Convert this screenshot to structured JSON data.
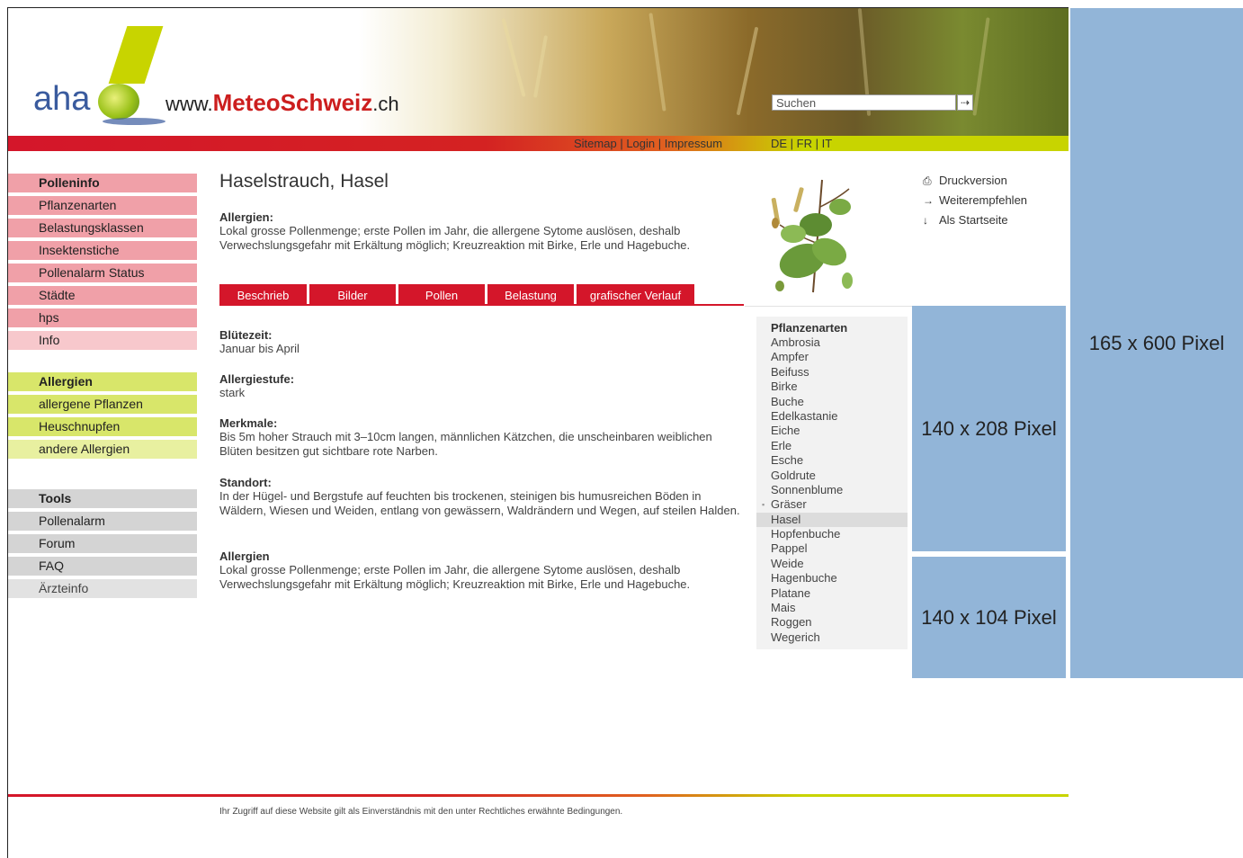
{
  "header": {
    "logo_text": "aha",
    "site_prefix": "www.",
    "site_name": "MeteoSchweiz",
    "site_suffix": ".ch",
    "search_placeholder": "Suchen",
    "search_button": "⇢"
  },
  "band": {
    "links": [
      "Sitemap",
      "Login",
      "Impressum"
    ],
    "separator": " | ",
    "languages": [
      "DE",
      "FR",
      "IT"
    ]
  },
  "nav": {
    "pollen": [
      "Polleninfo",
      "Pflanzenarten",
      "Belastungsklassen",
      "Insektenstiche",
      "Pollenalarm Status",
      "Städte",
      "hps",
      "Info"
    ],
    "allergien": [
      "Allergien",
      "allergene Pflanzen",
      "Heuschnupfen",
      "andere Allergien"
    ],
    "tools": [
      "Tools",
      "Pollenalarm",
      "Forum",
      "FAQ",
      "Ärzteinfo"
    ]
  },
  "main": {
    "title": "Haselstrauch, Hasel",
    "intro_heading": "Allergien:",
    "intro_text": "Lokal grosse Pollenmenge; erste Pollen im Jahr, die allergene Sytome auslösen, deshalb Verwechslungsgefahr mit Erkältung möglich; Kreuzreaktion mit Birke, Erle und Hagebuche.",
    "tabs": [
      "Beschrieb",
      "Bilder",
      "Pollen",
      "Belastung",
      "grafischer Verlauf"
    ],
    "sections": [
      {
        "heading": "Blütezeit:",
        "text": "Januar bis April"
      },
      {
        "heading": "Allergiestufe:",
        "text": "stark"
      },
      {
        "heading": "Merkmale:",
        "text": "Bis 5m hoher Strauch mit 3–10cm langen, männlichen Kätzchen, die unscheinbaren weiblichen Blüten besitzen gut sichtbare rote Narben."
      },
      {
        "heading": "Standort:",
        "text": "In der Hügel- und Bergstufe auf feuchten bis trockenen, steinigen bis humusreichen Böden in Wäldern, Wiesen und Weiden, entlang von gewässern, Waldrändern und Wegen, auf steilen Halden."
      },
      {
        "heading": "Allergien",
        "text": "Lokal grosse Pollenmenge; erste Pollen im Jahr, die allergene Sytome auslösen, deshalb Verwechslungsgefahr mit Erkältung möglich; Kreuzreaktion mit Birke, Erle und Hagebuche."
      }
    ]
  },
  "tools": [
    {
      "icon": "print-icon",
      "glyph": "⎙",
      "label": "Druckversion"
    },
    {
      "icon": "arrow-right-icon",
      "glyph": "→",
      "label": "Weiterempfehlen"
    },
    {
      "icon": "arrow-down-icon",
      "glyph": "↓",
      "label": "Als Startseite"
    }
  ],
  "plant_list": {
    "heading": "Pflanzenarten",
    "items": [
      "Ambrosia",
      "Ampfer",
      "Beifuss",
      "Birke",
      "Buche",
      "Edelkastanie",
      "Eiche",
      "Erle",
      "Esche",
      "Goldrute",
      "Sonnenblume",
      "Gräser",
      "Hasel",
      "Hopfenbuche",
      "Pappel",
      "Weide",
      "Hagenbuche",
      "Platane",
      "Mais",
      "Roggen",
      "Wegerich"
    ],
    "active": "Hasel",
    "bullet_item": "Gräser"
  },
  "ads": {
    "skyscraper": "165 x 600 Pixel",
    "medium": "140 x 208 Pixel",
    "small": "140 x 104 Pixel"
  },
  "footer": {
    "text": "Ihr Zugriff auf diese Website gilt als Einverständnis mit den unter Rechtliches erwähnte Bedingungen."
  },
  "colors": {
    "brand_red": "#d4162a",
    "brand_lime": "#c8d400",
    "ad_blue": "#92b5d8"
  }
}
